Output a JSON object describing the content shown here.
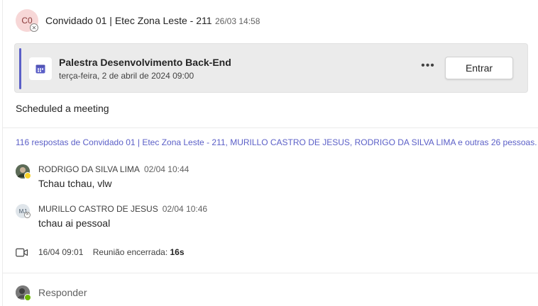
{
  "header": {
    "avatar_initials": "C0",
    "author": "Convidado 01 | Etec Zona Leste - 211",
    "timestamp": "26/03 14:58"
  },
  "meeting_card": {
    "title": "Palestra Desenvolvimento Back-End",
    "date": "terça-feira, 2 de abril de 2024 09:00",
    "more_label": "•••",
    "join_label": "Entrar",
    "accent_color": "#5b5fc7"
  },
  "post_text": "Scheduled a meeting",
  "replies_summary": "116 respostas de Convidado 01 | Etec Zona Leste - 211, MURILLO CASTRO DE JESUS, RODRIGO DA SILVA LIMA e outras 26 pessoas.",
  "replies": [
    {
      "name": "RODRIGO DA SILVA LIMA",
      "time": "02/04 10:44",
      "text": "Tchau tchau, vlw",
      "status": "away"
    },
    {
      "name": "MURILLO CASTRO DE JESUS",
      "initials": "MJ",
      "time": "02/04 10:46",
      "text": "tchau ai pessoal",
      "status": "offline"
    }
  ],
  "meeting_ended": {
    "time": "16/04 09:01",
    "label": "Reunião encerrada:",
    "duration": "16s"
  },
  "reply_button_label": "Responder"
}
